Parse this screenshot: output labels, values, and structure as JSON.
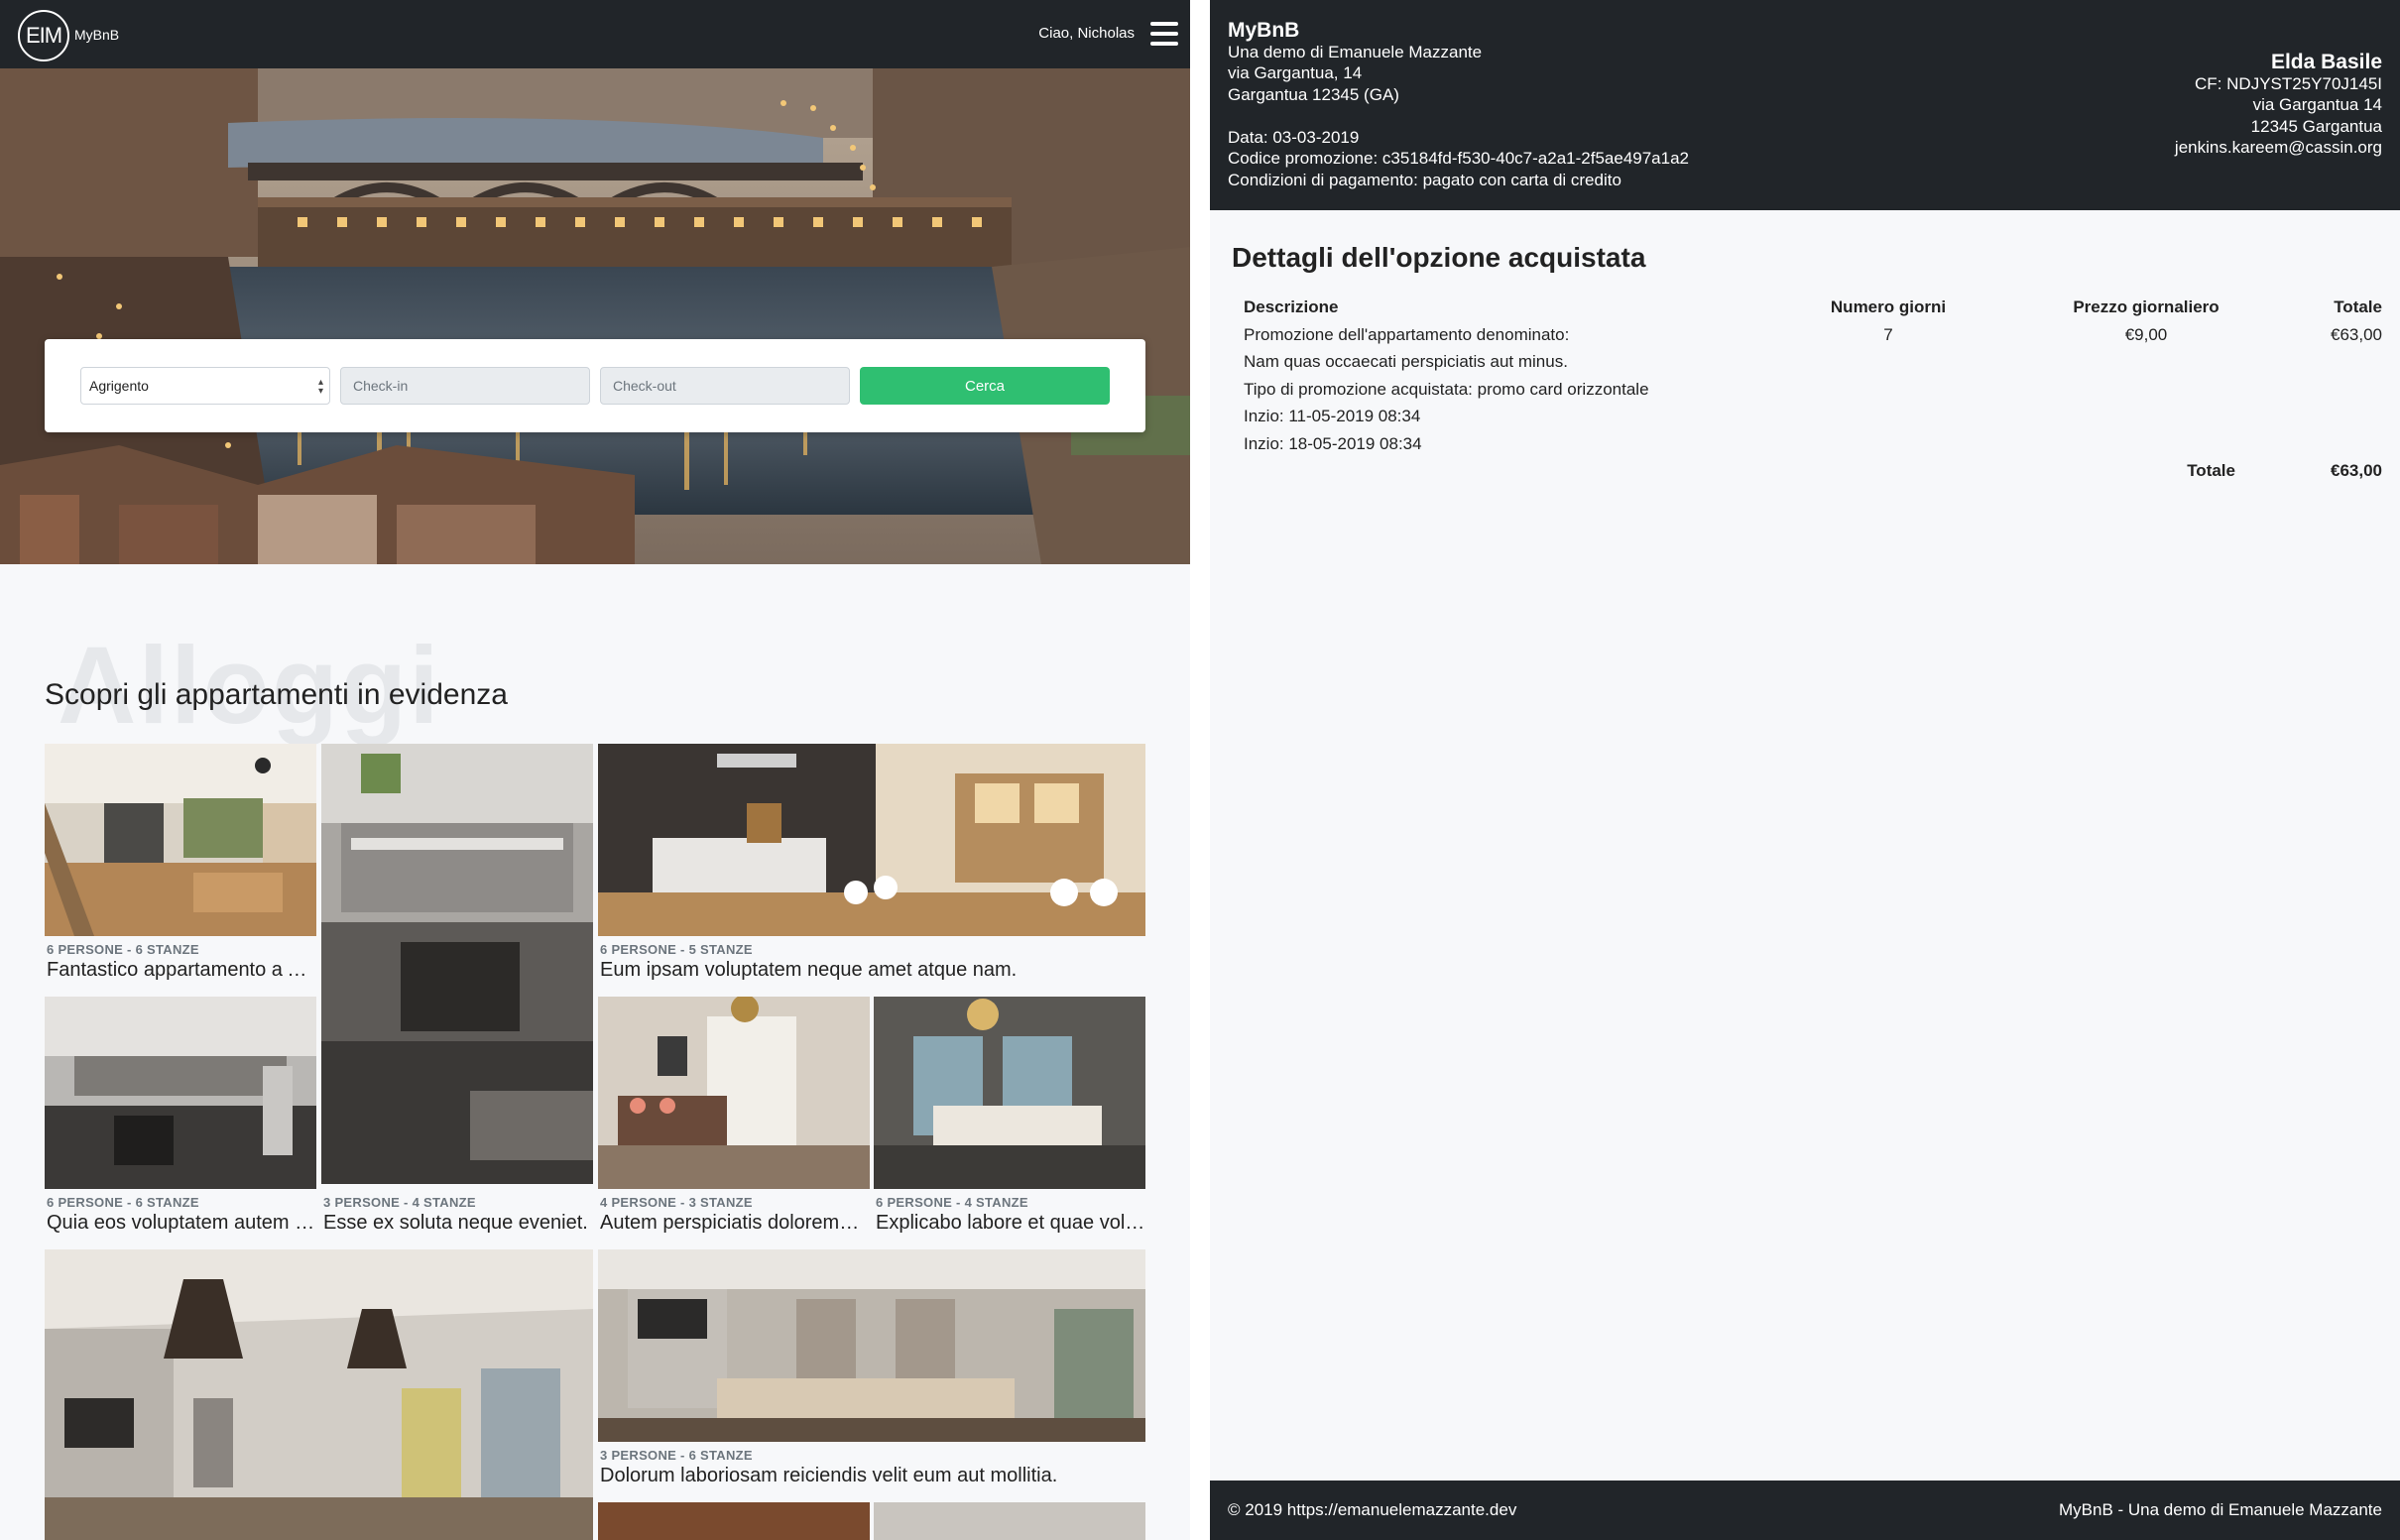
{
  "left": {
    "logo": {
      "badge": "EIM",
      "text": "MyBnB"
    },
    "greeting": "Ciao, Nicholas",
    "menu_icon": "hamburger-icon",
    "search": {
      "city": "Agrigento",
      "checkin_placeholder": "Check-in",
      "checkout_placeholder": "Check-out",
      "button": "Cerca"
    },
    "section": {
      "bg_word": "Alloggi",
      "title": "Scopri gli appartamenti in evidenza"
    },
    "cards": [
      {
        "meta": "6 PERSONE - 6 STANZE",
        "name": "Fantastico appartamento a Agrigento"
      },
      {
        "meta": "6 PERSONE - 5 STANZE",
        "name": "Eum ipsam voluptatem neque amet atque nam."
      },
      {
        "meta": "6 PERSONE - 6 STANZE",
        "name": "Quia eos voluptatem autem quis."
      },
      {
        "meta": "3 PERSONE - 4 STANZE",
        "name": "Esse ex soluta neque eveniet."
      },
      {
        "meta": "4 PERSONE - 3 STANZE",
        "name": "Autem perspiciatis doloremque."
      },
      {
        "meta": "6 PERSONE - 4 STANZE",
        "name": "Explicabo labore et quae voluptas."
      },
      {
        "meta": "3 PERSONE - 6 STANZE",
        "name": "Dolorum laboriosam reiciendis velit eum aut mollitia."
      }
    ]
  },
  "right": {
    "seller": {
      "brand": "MyBnB",
      "lines": [
        "Una demo di Emanuele Mazzante",
        "via Gargantua, 14",
        "Gargantua 12345 (GA)"
      ],
      "date": "Data: 03-03-2019",
      "promo_code": "Codice promozione: c35184fd-f530-40c7-a2a1-2f5ae497a1a2",
      "payment": "Condizioni di pagamento: pagato con carta di credito"
    },
    "buyer": {
      "name": "Elda Basile",
      "cf": "CF: NDJYST25Y70J145I",
      "street": "via Gargantua 14",
      "city": "12345 Gargantua",
      "email": "jenkins.kareem@cassin.org"
    },
    "title": "Dettagli dell'opzione acquistata",
    "table": {
      "headers": {
        "desc": "Descrizione",
        "days": "Numero giorni",
        "price": "Prezzo giornaliero",
        "total": "Totale"
      },
      "main_row": {
        "desc": "Promozione dell'appartamento denominato:",
        "days": "7",
        "price": "€9,00",
        "total": "€63,00"
      },
      "lines": [
        "Nam quas occaecati perspiciatis aut minus.",
        "Tipo di promozione acquistata: promo card orizzontale",
        "Inzio: 11-05-2019 08:34",
        "Inzio: 18-05-2019 08:34"
      ],
      "total_label": "Totale",
      "total_value": "€63,00"
    },
    "footer": {
      "left": "© 2019 https://emanuelemazzante.dev",
      "right": "MyBnB - Una demo di Emanuele Mazzante"
    }
  }
}
